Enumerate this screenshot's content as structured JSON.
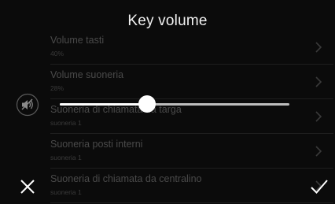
{
  "header": {
    "title": "Key volume"
  },
  "list": {
    "items": [
      {
        "label": "Volume tasti",
        "value": "40%"
      },
      {
        "label": "Volume suoneria",
        "value": "28%"
      },
      {
        "label": "Suoneria di chiamata da targa",
        "value": "suoneria 1"
      },
      {
        "label": "Suoneria posti interni",
        "value": "suoneria 1"
      },
      {
        "label": "Suoneria di chiamata da centralino",
        "value": "suoneria 1"
      }
    ]
  },
  "volume_slider": {
    "level": 0.38,
    "icon": "speaker-muted-icon"
  },
  "footer": {
    "close_icon": "close-icon",
    "confirm_icon": "check-icon"
  },
  "colors": {
    "background": "#0b0b0b",
    "text": "#f2f2f2",
    "dimmed_text": "#4a4a4a",
    "slider_track": "#bdbdbd",
    "slider_thumb": "#ffffff"
  }
}
